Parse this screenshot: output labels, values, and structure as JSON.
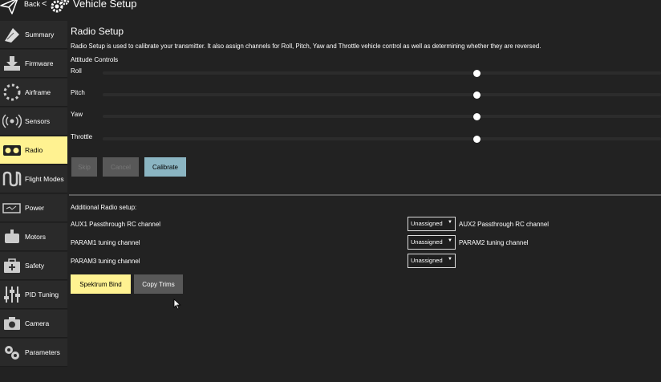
{
  "header": {
    "back_label": "Back",
    "separator": "<",
    "title": "Vehicle Setup"
  },
  "sidebar": {
    "items": [
      {
        "label": "Summary",
        "icon": "clipboard-icon"
      },
      {
        "label": "Firmware",
        "icon": "download-icon"
      },
      {
        "label": "Airframe",
        "icon": "airframe-icon"
      },
      {
        "label": "Sensors",
        "icon": "sensors-icon"
      },
      {
        "label": "Radio",
        "icon": "radio-icon",
        "active": true
      },
      {
        "label": "Flight Modes",
        "icon": "flight-modes-icon"
      },
      {
        "label": "Power",
        "icon": "battery-icon"
      },
      {
        "label": "Motors",
        "icon": "motors-icon"
      },
      {
        "label": "Safety",
        "icon": "first-aid-icon"
      },
      {
        "label": "PID Tuning",
        "icon": "sliders-icon"
      },
      {
        "label": "Camera",
        "icon": "camera-icon"
      },
      {
        "label": "Parameters",
        "icon": "gears-icon"
      }
    ]
  },
  "radio": {
    "title": "Radio Setup",
    "description": "Radio Setup is used to calibrate your transmitter. It also assign channels for Roll, Pitch, Yaw and Throttle vehicle control as well as determining whether they are reversed.",
    "attitude_label": "Attitude Controls",
    "sliders": [
      {
        "label": "Roll",
        "value": 0.67
      },
      {
        "label": "Pitch",
        "value": 0.67
      },
      {
        "label": "Yaw",
        "value": 0.67
      },
      {
        "label": "Throttle",
        "value": 0.67
      }
    ],
    "buttons": {
      "skip": "Skip",
      "cancel": "Cancel",
      "calibrate": "Calibrate"
    },
    "additional_label": "Additional Radio setup:",
    "channels": [
      {
        "left_label": "AUX1 Passthrough RC channel",
        "value": "Unassigned",
        "right_label": "AUX2 Passthrough RC channel"
      },
      {
        "left_label": "PARAM1 tuning channel",
        "value": "Unassigned",
        "right_label": "PARAM2 tuning channel"
      },
      {
        "left_label": "PARAM3 tuning channel",
        "value": "Unassigned",
        "right_label": ""
      }
    ],
    "spektrum_bind": "Spektrum Bind",
    "copy_trims": "Copy Trims"
  },
  "colors": {
    "background": "#222222",
    "active": "#fff291",
    "calibrate": "#8bb5c2",
    "disabled_button": "#585858"
  }
}
